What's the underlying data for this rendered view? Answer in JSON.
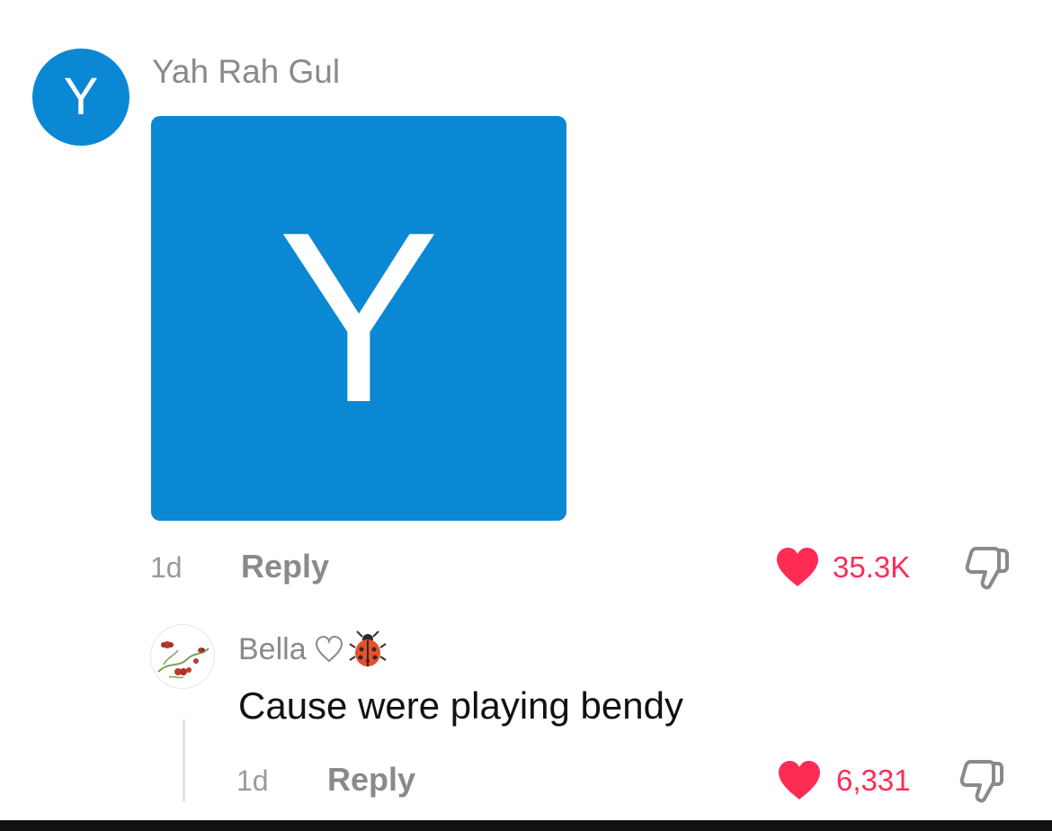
{
  "comment": {
    "avatar_letter": "Y",
    "username": "Yah Rah Gul",
    "image_letter": "Y",
    "time": "1d",
    "reply_label": "Reply",
    "likes": "35.3K"
  },
  "reply": {
    "username": "Bella",
    "text": "Cause were playing bendy",
    "time": "1d",
    "reply_label": "Reply",
    "likes": "6,331"
  },
  "colors": {
    "avatar_blue": "#0a88d4",
    "like_red": "#fe2c55",
    "meta_gray": "#8a8a8a"
  },
  "icons": {
    "like": "heart-filled-icon",
    "dislike": "thumbs-down-icon",
    "username_emoji_1": "heart-outline-icon",
    "username_emoji_2": "ladybug-icon"
  }
}
